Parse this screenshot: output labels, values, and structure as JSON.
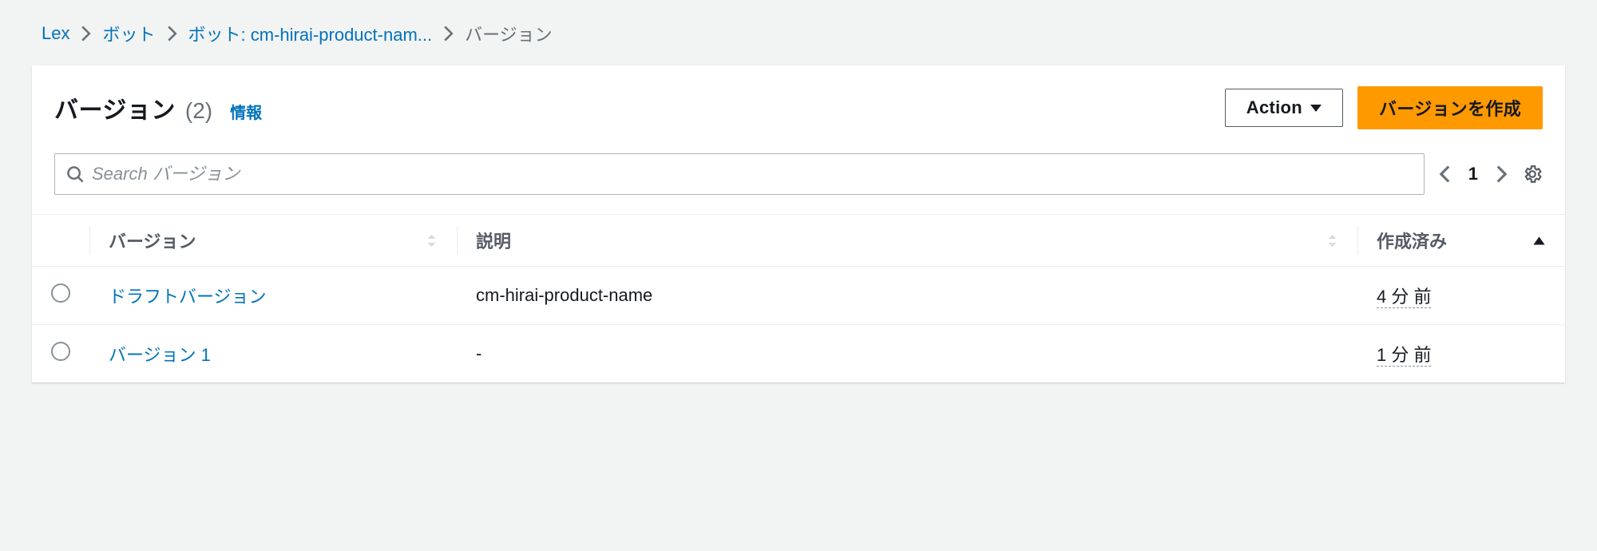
{
  "breadcrumb": {
    "items": [
      {
        "label": "Lex"
      },
      {
        "label": "ボット"
      },
      {
        "label": "ボット: cm-hirai-product-nam..."
      }
    ],
    "current": "バージョン"
  },
  "header": {
    "title": "バージョン",
    "count": "(2)",
    "info": "情報"
  },
  "actions": {
    "action_label": "Action",
    "create_label": "バージョンを作成"
  },
  "search": {
    "placeholder": "Search バージョン"
  },
  "pagination": {
    "page": "1"
  },
  "table": {
    "columns": {
      "version": "バージョン",
      "description": "説明",
      "created": "作成済み"
    },
    "rows": [
      {
        "version": "ドラフトバージョン",
        "description": "cm-hirai-product-name",
        "created": "4 分 前"
      },
      {
        "version": "バージョン 1",
        "description": "-",
        "created": "1 分 前"
      }
    ]
  }
}
